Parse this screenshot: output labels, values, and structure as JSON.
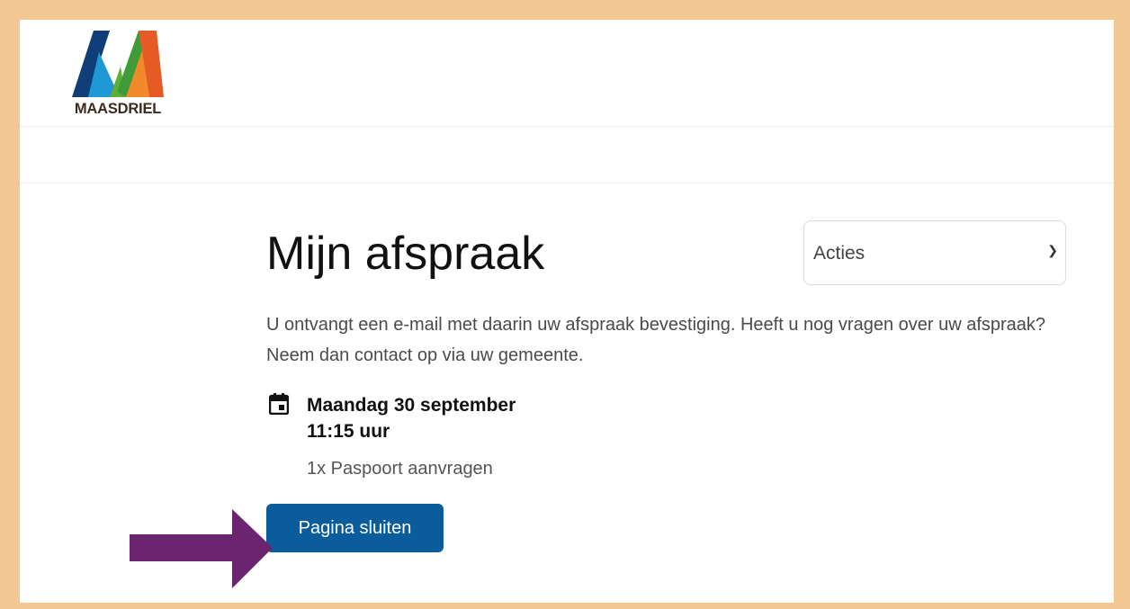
{
  "logo": {
    "text": "MAASDRIEL",
    "icon": "maasdriel-m-logo"
  },
  "page": {
    "title": "Mijn afspraak",
    "actions_select": {
      "selected": "Acties"
    },
    "intro": "U ontvangt een e-mail met daarin uw afspraak bevestiging. Heeft u nog vragen over uw afspraak? Neem dan contact op via uw gemeente.",
    "appointment": {
      "icon": "calendar-icon",
      "date": "Maandag 30 september",
      "time": "11:15 uur",
      "service": "1x Paspoort aanvragen"
    },
    "close_button": "Pagina sluiten"
  },
  "annotation": {
    "icon": "arrow-right-icon",
    "color": "#6b246f"
  },
  "colors": {
    "frame_border": "#f2c792",
    "button": "#0b5c9a"
  }
}
